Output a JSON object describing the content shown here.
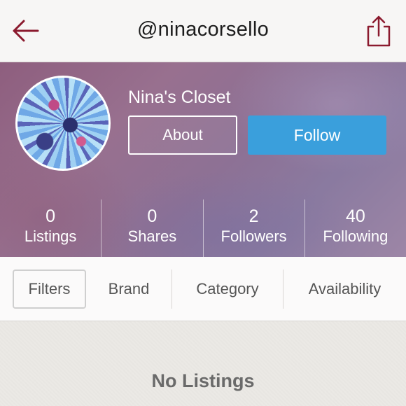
{
  "nav": {
    "username": "@ninacorsello",
    "back_icon": "back-arrow-icon",
    "share_icon": "share-icon",
    "accent": "#8b1a2e"
  },
  "profile": {
    "closet_name": "Nina's Closet",
    "about_label": "About",
    "follow_label": "Follow",
    "follow_color": "#3a9fdc"
  },
  "stats": [
    {
      "value": "0",
      "label": "Listings"
    },
    {
      "value": "0",
      "label": "Shares"
    },
    {
      "value": "2",
      "label": "Followers"
    },
    {
      "value": "40",
      "label": "Following"
    }
  ],
  "filters": {
    "filters_label": "Filters",
    "brand_label": "Brand",
    "category_label": "Category",
    "availability_label": "Availability"
  },
  "content": {
    "empty_message": "No Listings"
  }
}
